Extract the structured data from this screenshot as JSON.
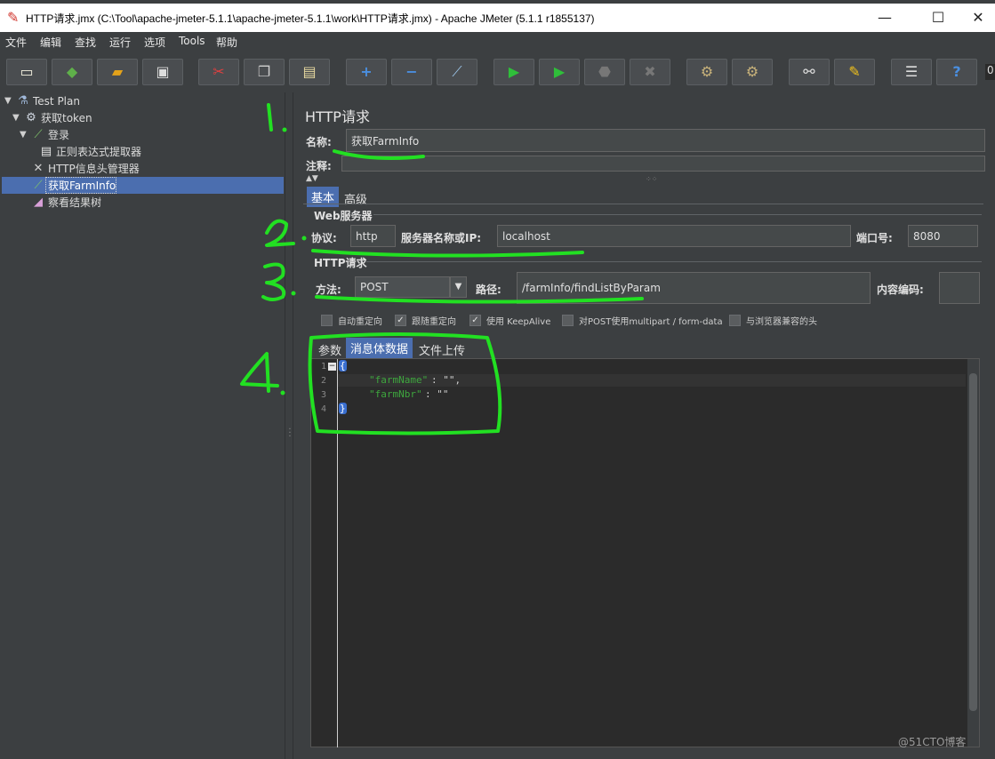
{
  "window": {
    "title": "HTTP请求.jmx (C:\\Tool\\apache-jmeter-5.1.1\\apache-jmeter-5.1.1\\work\\HTTP请求.jmx) - Apache JMeter (5.1.1 r1855137)",
    "minimize": "—",
    "maximize": "☐",
    "close": "✕"
  },
  "menu": [
    "文件",
    "编辑",
    "查找",
    "运行",
    "选项",
    "Tools",
    "帮助"
  ],
  "toolbar": {
    "icons": [
      "new-icon",
      "templates-icon",
      "open-icon",
      "save-icon",
      "cut-icon",
      "copy-icon",
      "paste-icon",
      "expand-icon",
      "collapse-icon",
      "toggle-icon",
      "start-icon",
      "start-no-pause-icon",
      "stop-icon",
      "shutdown-icon",
      "clear-icon",
      "clear-all-icon",
      "search-icon",
      "reset-search-icon",
      "function-helper-icon",
      "help-icon"
    ],
    "counter": "0"
  },
  "tree": {
    "items": [
      {
        "label": "Test Plan",
        "toggle": "▼"
      },
      {
        "label": "获取token",
        "toggle": "▼"
      },
      {
        "label": "登录",
        "toggle": "▼"
      },
      {
        "label": "正则表达式提取器",
        "toggle": ""
      },
      {
        "label": "HTTP信息头管理器",
        "toggle": ""
      },
      {
        "label": "获取FarmInfo",
        "toggle": ""
      },
      {
        "label": "察看结果树",
        "toggle": ""
      }
    ]
  },
  "panel": {
    "title": "HTTP请求",
    "name_label": "名称:",
    "name_value": "获取FarmInfo",
    "comment_label": "注释:",
    "tabs": [
      "基本",
      "高级"
    ],
    "web_server": {
      "group_title": "Web服务器",
      "protocol_label": "协议:",
      "protocol_value": "http",
      "server_label": "服务器名称或IP:",
      "server_value": "localhost",
      "port_label": "端口号:",
      "port_value": "8080"
    },
    "http_request": {
      "group_title": "HTTP请求",
      "method_label": "方法:",
      "method_value": "POST",
      "path_label": "路径:",
      "path_value": "/farmInfo/findListByParam",
      "encoding_label": "内容编码:",
      "encoding_value": ""
    },
    "checkboxes": [
      {
        "label": "自动重定向",
        "checked": false
      },
      {
        "label": "跟随重定向",
        "checked": true
      },
      {
        "label": "使用 KeepAlive",
        "checked": true
      },
      {
        "label": "对POST使用multipart / form-data",
        "checked": false
      },
      {
        "label": "与浏览器兼容的头",
        "checked": false
      }
    ],
    "body_tabs": [
      "参数",
      "消息体数据",
      "文件上传"
    ],
    "body_active_tab": 1,
    "code": {
      "line_numbers": [
        "1",
        "2",
        "3",
        "4"
      ],
      "open_brace": "{",
      "line2_key": "\"farmName\"",
      "line2_rest": ": \"\",",
      "line3_key": "\"farmNbr\"",
      "line3_rest": ": \"\"",
      "close_brace": "}"
    }
  },
  "annotations": [
    "1.",
    "2.",
    "3.",
    "4."
  ],
  "watermark": "@51CTO博客"
}
